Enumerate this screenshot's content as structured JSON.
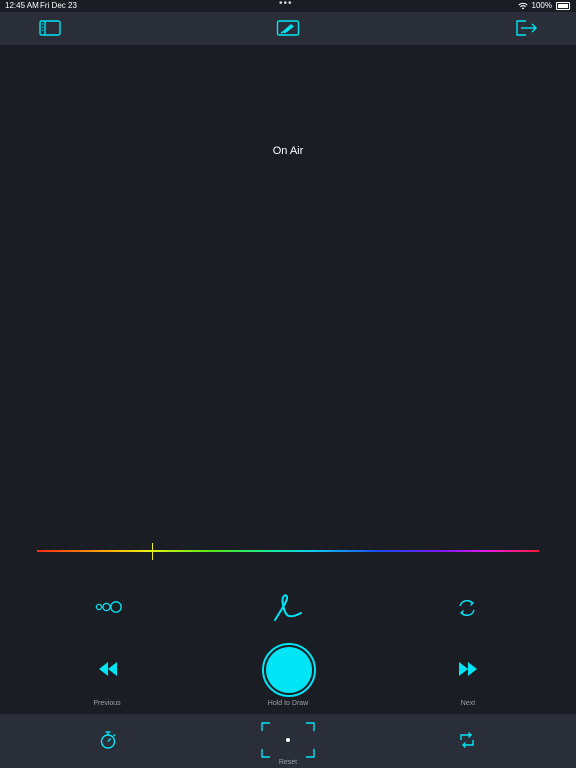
{
  "status_bar": {
    "time": "12:45 AM",
    "date": "Fri Dec 23",
    "battery": "100%"
  },
  "top_bar": {
    "left_icon": "sidebar-panel-icon",
    "center_icon": "marker-tablet-icon",
    "right_icon": "exit-arrow-icon"
  },
  "canvas": {
    "status_text": "On Air"
  },
  "color_picker": {
    "selected_hue_fraction": 0.23,
    "accent_color": "#00e5f5"
  },
  "controls": {
    "previous_label": "Previous",
    "hold_to_draw_label": "Hold to Draw",
    "next_label": "Next"
  },
  "bottom_bar": {
    "reset_label": "Reset",
    "timer_icon": "timer-icon",
    "repeat_icon": "repeat-icon"
  }
}
